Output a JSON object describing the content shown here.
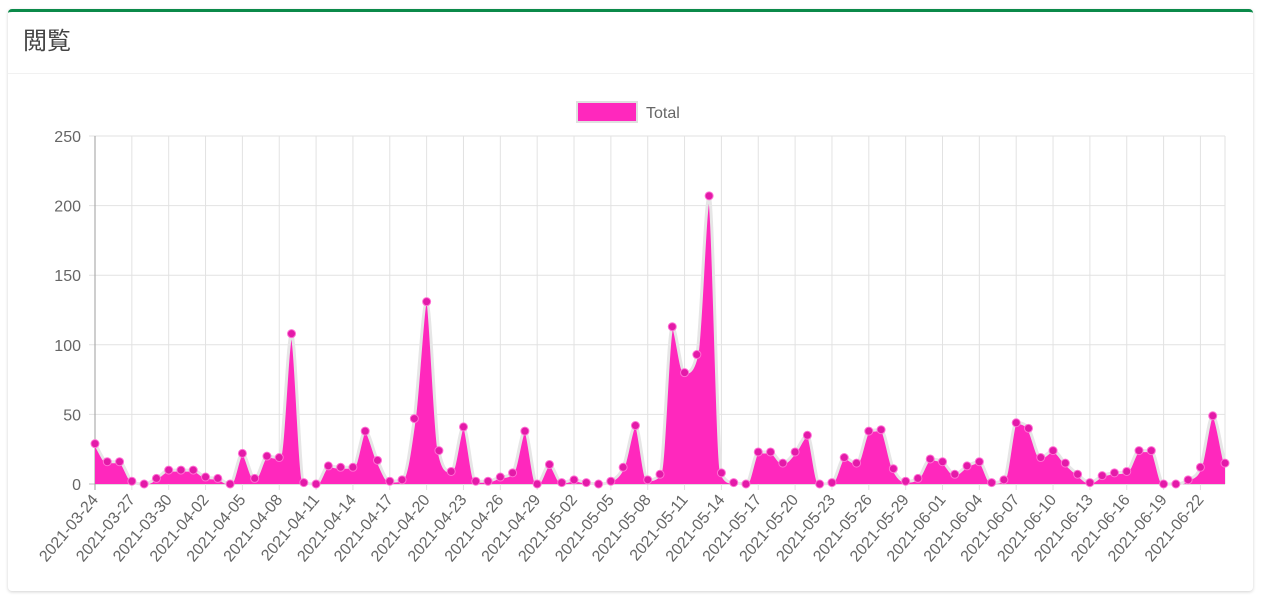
{
  "header": {
    "title": "閲覧"
  },
  "colors": {
    "accent": "#0b8a4a",
    "series": "#ff28bd",
    "point": "#e31aa8"
  },
  "chart_data": {
    "type": "area",
    "legend": {
      "position": "top",
      "entries": [
        "Total"
      ]
    },
    "grid": true,
    "ylim": [
      0,
      250
    ],
    "yticks": [
      0,
      50,
      100,
      150,
      200,
      250
    ],
    "xtick_labels": [
      "2021-03-24",
      "2021-03-27",
      "2021-03-30",
      "2021-04-02",
      "2021-04-05",
      "2021-04-08",
      "2021-04-11",
      "2021-04-14",
      "2021-04-17",
      "2021-04-20",
      "2021-04-23",
      "2021-04-26",
      "2021-04-29",
      "2021-05-02",
      "2021-05-05",
      "2021-05-08",
      "2021-05-11",
      "2021-05-14",
      "2021-05-17",
      "2021-05-20",
      "2021-05-23",
      "2021-05-26",
      "2021-05-29",
      "2021-06-01",
      "2021-06-04",
      "2021-06-07",
      "2021-06-10",
      "2021-06-13",
      "2021-06-16",
      "2021-06-19",
      "2021-06-22"
    ],
    "x_start": "2021-03-24",
    "x_end": "2021-06-23",
    "series": [
      {
        "name": "Total",
        "values": [
          29,
          16,
          16,
          2,
          0,
          4,
          10,
          10,
          10,
          5,
          4,
          0,
          22,
          4,
          20,
          19,
          108,
          1,
          0,
          13,
          12,
          12,
          38,
          17,
          2,
          3,
          47,
          131,
          24,
          9,
          41,
          2,
          2,
          5,
          8,
          38,
          0,
          14,
          1,
          3,
          1,
          0,
          2,
          12,
          42,
          3,
          7,
          113,
          80,
          93,
          207,
          8,
          1,
          0,
          23,
          23,
          15,
          23,
          35,
          0,
          1,
          19,
          15,
          38,
          39,
          11,
          2,
          4,
          18,
          16,
          7,
          13,
          16,
          1,
          3,
          44,
          40,
          19,
          24,
          15,
          7,
          1,
          6,
          8,
          9,
          24,
          24,
          0,
          0,
          3,
          12,
          49,
          15
        ]
      }
    ]
  }
}
